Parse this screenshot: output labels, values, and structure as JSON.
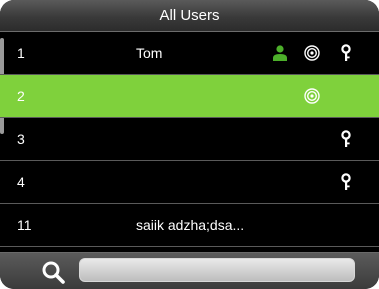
{
  "title": "All Users",
  "colors": {
    "selected_row": "#7fd13c",
    "user_icon": "#4caf2a"
  },
  "users": [
    {
      "id": "1",
      "name": "Tom",
      "icons": [
        "user-icon",
        "fingerprint-icon",
        "key-icon"
      ]
    },
    {
      "id": "2",
      "name": "",
      "icons": [
        "fingerprint-icon"
      ],
      "selected": true
    },
    {
      "id": "3",
      "name": "",
      "icons": [
        "key-icon"
      ]
    },
    {
      "id": "4",
      "name": "",
      "icons": [
        "key-icon"
      ]
    },
    {
      "id": "11",
      "name": "saiik adzha;dsa...",
      "icons": []
    }
  ],
  "search": {
    "icon": "search-icon",
    "value": ""
  }
}
